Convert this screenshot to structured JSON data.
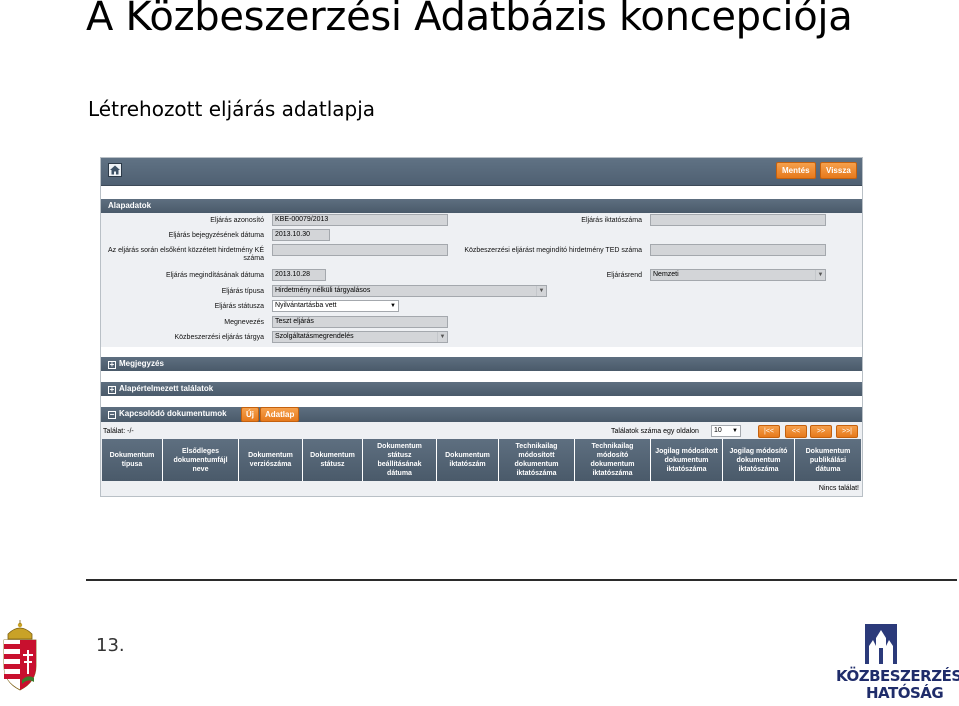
{
  "slide": {
    "title": "A Közbeszerzési Adatbázis koncepciója",
    "subtitle": "Létrehozott eljárás adatlapja",
    "page_number": "13."
  },
  "toolbar": {
    "save_label": "Mentés",
    "back_label": "Vissza"
  },
  "sections": {
    "basic": "Alapadatok",
    "notes": "Megjegyzés",
    "default_results": "Alapértelmezett találatok",
    "related_docs": "Kapcsolódó dokumentumok",
    "new_label": "Új",
    "datasheet_label": "Adatlap"
  },
  "form": {
    "id_label": "Eljárás azonosító",
    "id_value": "KBE-00079/2013",
    "entry_date_label": "Eljárás bejegyzésének dátuma",
    "entry_date_value": "2013.10.30",
    "ke_notice_label": "Az eljárás során elsőként közzétett hirdetmény KÉ száma",
    "ke_notice_value": "",
    "start_date_label": "Eljárás megindításának dátuma",
    "start_date_value": "2013.10.28",
    "type_label": "Eljárás típusa",
    "type_value": "Hirdetmény nélküli tárgyalásos",
    "status_label": "Eljárás státusza",
    "status_value": "Nyilvántartásba vett",
    "name_label": "Megnevezés",
    "name_value": "Teszt eljárás",
    "subject_label": "Közbeszerzési eljárás tárgya",
    "subject_value": "Szolgáltatásmegrendelés",
    "filing_label": "Eljárás iktatószáma",
    "filing_value": "",
    "ted_label": "Közbeszerzési eljárást megindító hirdetmény TED száma",
    "ted_value": "",
    "regime_label": "Eljárásrend",
    "regime_value": "Nemzeti"
  },
  "grid": {
    "result_count": "Találat: -/-",
    "per_page_label": "Találatok száma egy oldalon",
    "per_page_value": "10",
    "pager": [
      "|<<",
      "<<",
      ">>",
      ">>|"
    ],
    "headers": [
      "Dokumentum típusa",
      "Elsődleges dokumentumfájl neve",
      "Dokumentum verziószáma",
      "Dokumentum státusz",
      "Dokumentum státusz beállításának dátuma",
      "Dokumentum iktatószám",
      "Technikailag módosított dokumentum iktatószáma",
      "Technikailag módosító dokumentum iktatószáma",
      "Jogilag módosított dokumentum iktatószáma",
      "Jogilag módosító dokumentum iktatószáma",
      "Dokumentum publikálási dátuma"
    ],
    "no_results": "Nincs találat!"
  },
  "logo": {
    "line1": "KÖZBESZERZÉSI",
    "line2": "HATÓSÁG"
  },
  "colors": {
    "header_bar": "#4f6072",
    "accent_orange": "#e6791c",
    "field_gray": "#d3d5d8",
    "logo_blue": "#1f2c6a"
  }
}
